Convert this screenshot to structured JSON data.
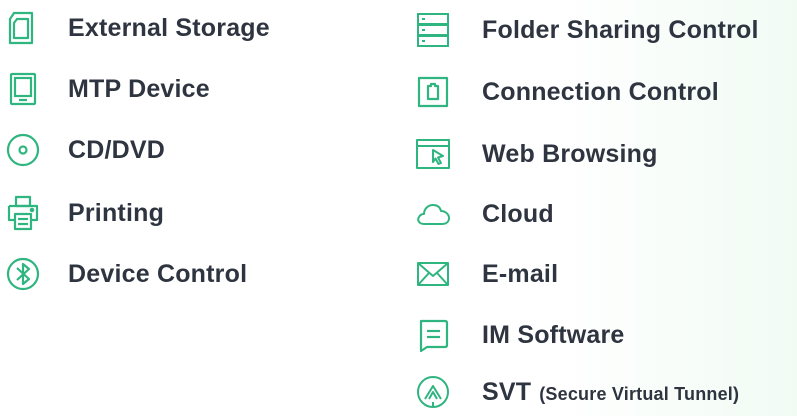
{
  "left_items": [
    {
      "label": "External Storage",
      "icon": "sd-card-icon"
    },
    {
      "label": "MTP Device",
      "icon": "tablet-icon"
    },
    {
      "label": "CD/DVD",
      "icon": "disc-icon"
    },
    {
      "label": "Printing",
      "icon": "printer-icon"
    },
    {
      "label": "Device Control",
      "icon": "bluetooth-icon"
    }
  ],
  "right_items": [
    {
      "label": "Folder Sharing Control",
      "icon": "server-icon"
    },
    {
      "label": "Connection Control",
      "icon": "connection-icon"
    },
    {
      "label": "Web Browsing",
      "icon": "browser-window-icon"
    },
    {
      "label": "Cloud",
      "icon": "cloud-icon"
    },
    {
      "label": "E-mail",
      "icon": "envelope-icon"
    },
    {
      "label": "IM Software",
      "icon": "chat-icon"
    },
    {
      "label": "SVT",
      "sublabel": "(Secure Virtual Tunnel)",
      "icon": "tunnel-icon"
    }
  ],
  "colors": {
    "accent": "#2fb57f",
    "text": "#2f3540"
  }
}
